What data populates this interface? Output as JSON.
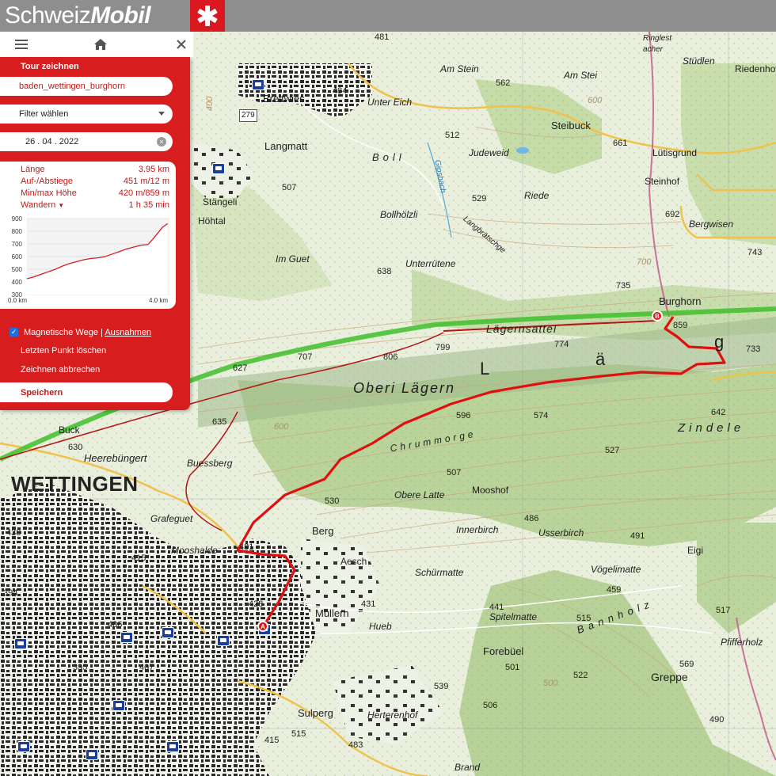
{
  "header": {
    "logo_part1": "Schweiz",
    "logo_part2": "Mobil",
    "cross_icon": "swiss-cross-icon"
  },
  "topbar": {
    "menu_icon": "hamburger-menu-icon",
    "home_icon": "home-icon",
    "close_icon": "close-icon"
  },
  "panel": {
    "title": "Tour zeichnen",
    "tour_name": "baden_wettingen_burghorn",
    "filter_label": "Filter wählen",
    "date": "26 . 04 . 2022",
    "stats": [
      {
        "label": "Länge",
        "value": "3.95 km"
      },
      {
        "label": "Auf-/Abstiege",
        "value": "451 m/12 m"
      },
      {
        "label": "Min/max Höhe",
        "value": "420 m/859 m"
      },
      {
        "label": "Wandern",
        "value": "1 h 35 min"
      }
    ],
    "magnetic_label": "Magnetische Wege",
    "magnetic_sep": "|",
    "exceptions_link": "Ausnahmen",
    "magnetic_checked": true,
    "delete_last": "Letzten Punkt löschen",
    "cancel_draw": "Zeichnen abbrechen",
    "save": "Speichern"
  },
  "chart_data": {
    "type": "area",
    "x": [
      0.0,
      0.2,
      0.4,
      0.6,
      0.8,
      1.0,
      1.2,
      1.4,
      1.6,
      1.8,
      2.0,
      2.2,
      2.4,
      2.6,
      2.8,
      3.0,
      3.2,
      3.4,
      3.6,
      3.8,
      3.95
    ],
    "series": [
      {
        "values": [
          425,
          440,
          460,
          480,
          500,
          525,
          545,
          560,
          575,
          585,
          590,
          600,
          620,
          640,
          660,
          675,
          690,
          695,
          760,
          830,
          860
        ]
      }
    ],
    "yticks": [
      "900",
      "800",
      "700",
      "600",
      "500",
      "400",
      "300"
    ],
    "ylim": [
      300,
      900
    ],
    "xlim": [
      0.0,
      4.0
    ],
    "xtick_labels": [
      "0.0 km",
      "4.0 km"
    ],
    "color": "#d81d1e"
  },
  "map": {
    "labels": [
      "WETTINGEN",
      "Oberi Lägern",
      "Lägernsattel",
      "Burghorn",
      "Steibuck",
      "Breitwies",
      "Langmatt",
      "Stängeli",
      "Höhtal",
      "Boll",
      "Bollhölzli",
      "Im Guet",
      "Unterrütene",
      "Riede",
      "Judeweid",
      "Am Stein",
      "Am Stei",
      "Unter Eich",
      "Langbrätschge",
      "Gipsbach",
      "Lütisgrund",
      "Steinhof",
      "Bergwisen",
      "Stüdlen",
      "Riedenhof",
      "Ringlest acher",
      "Chrummorge",
      "Zindele",
      "Buck",
      "Heerebüngert",
      "Buessberg",
      "Grafeguet",
      "Mooshalde",
      "Berg",
      "Aesch",
      "Obere Latte",
      "Mooshof",
      "Innerbirch",
      "Usserbirch",
      "Eigi",
      "Schürmatte",
      "Vögelimatte",
      "Müllern",
      "Hueb",
      "Spitelmatte",
      "Forebüel",
      "Bannholz",
      "Greppe",
      "Sulperg",
      "Herterenhof",
      "Pfifferholz",
      "Brand",
      "L",
      "ä",
      "g"
    ],
    "spot_heights": [
      "481",
      "484",
      "562",
      "661",
      "600",
      "512",
      "529",
      "507",
      "638",
      "735",
      "692",
      "743",
      "859",
      "733",
      "774",
      "799",
      "806",
      "707",
      "627",
      "642",
      "574",
      "596",
      "527",
      "507",
      "530",
      "635",
      "630",
      "481",
      "415",
      "428",
      "431",
      "441",
      "459",
      "491",
      "486",
      "515",
      "522",
      "501",
      "569",
      "517",
      "490",
      "539",
      "506",
      "515",
      "483",
      "415",
      "438",
      "394",
      "406",
      "407",
      "395",
      "279",
      "500",
      "600",
      "700",
      "400"
    ],
    "route_start": "A",
    "route_end": "B",
    "route_color": "#e01010",
    "trail_color": "#3fbf2a"
  }
}
